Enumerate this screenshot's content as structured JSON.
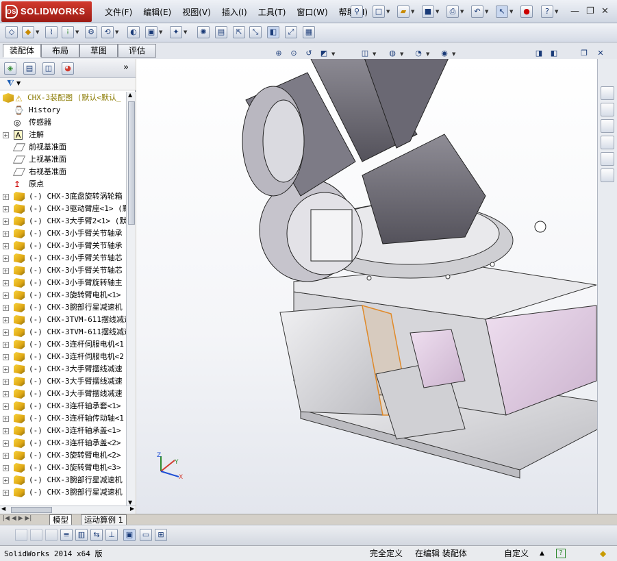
{
  "app": {
    "brand": "SOLIDWORKS",
    "brand_mark": "DS"
  },
  "menu": [
    "文件(F)",
    "编辑(E)",
    "视图(V)",
    "插入(I)",
    "工具(T)",
    "窗口(W)",
    "帮助(H)"
  ],
  "tabs": [
    {
      "label": "装配体",
      "active": true
    },
    {
      "label": "布局",
      "active": false
    },
    {
      "label": "草图",
      "active": false
    },
    {
      "label": "评估",
      "active": false
    }
  ],
  "tree": {
    "root_label": "CHX-3装配图  (默认<默认_",
    "items": [
      {
        "label": "History",
        "icon": "history-icon",
        "expandable": false
      },
      {
        "label": "传感器",
        "icon": "sensor-icon",
        "expandable": false
      },
      {
        "label": "注解",
        "icon": "annotation-icon",
        "expandable": true
      },
      {
        "label": "前视基准面",
        "icon": "plane-icon",
        "expandable": false
      },
      {
        "label": "上视基准面",
        "icon": "plane-icon",
        "expandable": false
      },
      {
        "label": "右视基准面",
        "icon": "plane-icon",
        "expandable": false
      },
      {
        "label": "原点",
        "icon": "origin-icon",
        "expandable": false
      },
      {
        "label": "(-) CHX-3底盘旋转涡轮箱",
        "icon": "part-icon",
        "expandable": true
      },
      {
        "label": "(-) CHX-3驱动臂座<1> (默",
        "icon": "part-icon",
        "expandable": true
      },
      {
        "label": "(-) CHX-3大手臂2<1> (默",
        "icon": "part-icon",
        "expandable": true
      },
      {
        "label": "(-) CHX-3小手臂关节轴承",
        "icon": "part-icon",
        "expandable": true
      },
      {
        "label": "(-) CHX-3小手臂关节轴承",
        "icon": "part-icon",
        "expandable": true
      },
      {
        "label": "(-) CHX-3小手臂关节轴芯",
        "icon": "part-icon",
        "expandable": true
      },
      {
        "label": "(-) CHX-3小手臂关节轴芯",
        "icon": "part-icon",
        "expandable": true
      },
      {
        "label": "(-) CHX-3小手臂旋转轴主",
        "icon": "part-icon",
        "expandable": true
      },
      {
        "label": "(-) CHX-3旋转臂电机<1>",
        "icon": "part-icon",
        "expandable": true
      },
      {
        "label": "(-) CHX-3腕部行星减速机",
        "icon": "part-icon",
        "expandable": true
      },
      {
        "label": "(-) CHX-3TVM-611摆线减速",
        "icon": "part-icon",
        "expandable": true
      },
      {
        "label": "(-) CHX-3TVM-611摆线减速",
        "icon": "part-icon",
        "expandable": true
      },
      {
        "label": "(-) CHX-3连杆伺服电机<1",
        "icon": "part-icon",
        "expandable": true
      },
      {
        "label": "(-) CHX-3连杆伺服电机<2",
        "icon": "part-icon",
        "expandable": true
      },
      {
        "label": "(-) CHX-3大手臂摆线减速",
        "icon": "part-icon",
        "expandable": true
      },
      {
        "label": "(-) CHX-3大手臂摆线减速",
        "icon": "part-icon",
        "expandable": true
      },
      {
        "label": "(-) CHX-3大手臂摆线减速",
        "icon": "part-icon",
        "expandable": true
      },
      {
        "label": "(-) CHX-3连杆轴承套<1>",
        "icon": "part-icon",
        "expandable": true
      },
      {
        "label": "(-) CHX-3连杆轴传动轴<1",
        "icon": "part-icon",
        "expandable": true
      },
      {
        "label": "(-) CHX-3连杆轴承盖<1>",
        "icon": "part-icon",
        "expandable": true
      },
      {
        "label": "(-) CHX-3连杆轴承盖<2>",
        "icon": "part-icon",
        "expandable": true
      },
      {
        "label": "(-) CHX-3旋转臂电机<2>",
        "icon": "part-icon",
        "expandable": true
      },
      {
        "label": "(-) CHX-3旋转臂电机<3>",
        "icon": "part-icon",
        "expandable": true
      },
      {
        "label": "(-) CHX-3腕部行星减速机",
        "icon": "part-icon",
        "expandable": true
      },
      {
        "label": "(-) CHX-3腕部行星减速机",
        "icon": "part-icon",
        "expandable": true
      }
    ]
  },
  "triad": {
    "z": "Z",
    "y": "Y",
    "x": "X"
  },
  "bottom_tabs": [
    {
      "label": "模型",
      "active": true
    },
    {
      "label": "运动算例 1",
      "active": false
    }
  ],
  "status": {
    "version": "SolidWorks 2014 x64 版",
    "definition": "完全定义",
    "mode": "在编辑 装配体",
    "units": "自定义"
  },
  "colors": {
    "accent": "#c8312a",
    "part_pink": "#e4cfe6",
    "part_gray": "#d9d9dc",
    "selection_orange": "#e08a2a"
  }
}
